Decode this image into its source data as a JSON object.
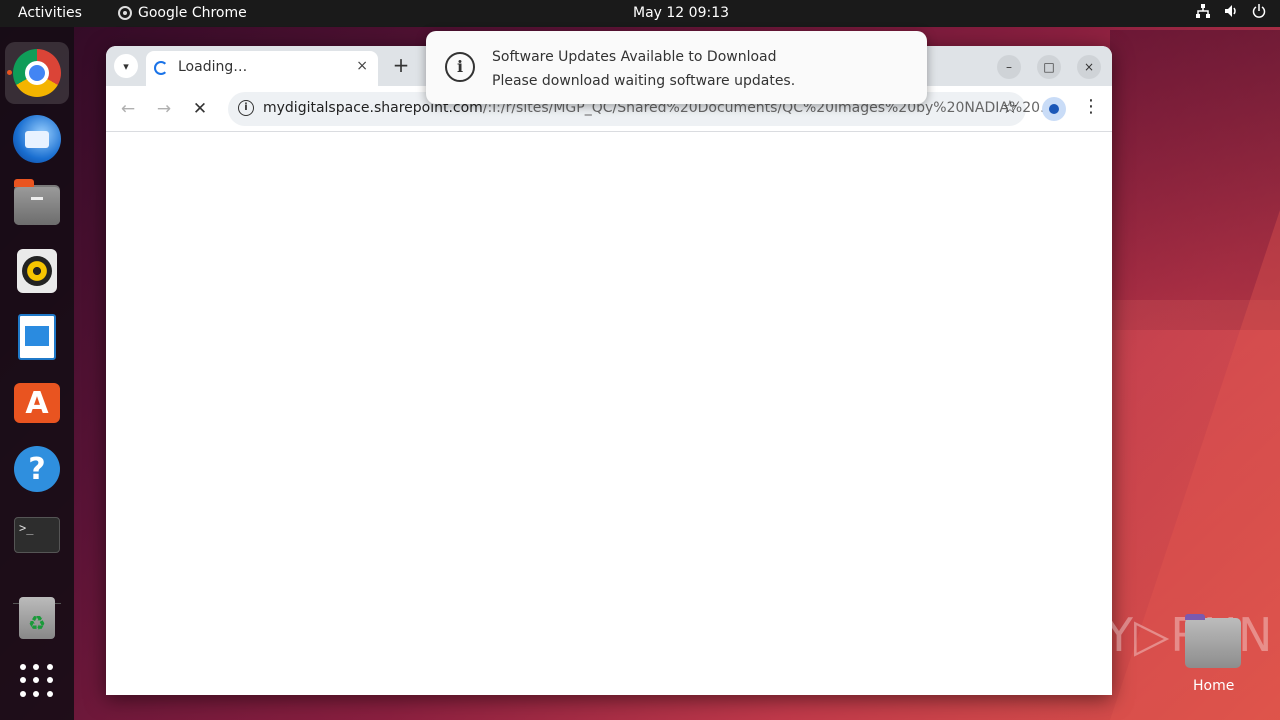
{
  "topbar": {
    "activities": "Activities",
    "app_name": "Google Chrome",
    "clock": "May 12  09:13",
    "tray_icons": [
      "network-icon",
      "volume-icon",
      "power-icon"
    ]
  },
  "dock": {
    "apps": [
      "Google Chrome",
      "Thunderbird Mail",
      "Files",
      "Rhythmbox",
      "LibreOffice Writer",
      "Ubuntu Software",
      "Help",
      "Terminal",
      "Trash",
      "Show Applications"
    ],
    "terminal_prompt": ">_"
  },
  "browser": {
    "tab_title": "Loading…",
    "tab_close": "×",
    "new_tab": "+",
    "url_host": "mydigitalspace.sharepoint.com",
    "url_rest": "/:i:/r/sites/MGP_QC/Shared%20Documents/QC%20images%20by%20NADIA%20…",
    "window_controls": {
      "minimize": "–",
      "maximize": "□",
      "close": "×"
    }
  },
  "notification": {
    "title": "Software Updates Available to Download",
    "body": "Please download waiting software updates."
  },
  "desktop": {
    "home_label": "Home",
    "watermark": "ANY▷RUN"
  },
  "colors": {
    "accent": "#e95420",
    "link_blue": "#1a73e8",
    "topbar": "#1a1a1a"
  }
}
